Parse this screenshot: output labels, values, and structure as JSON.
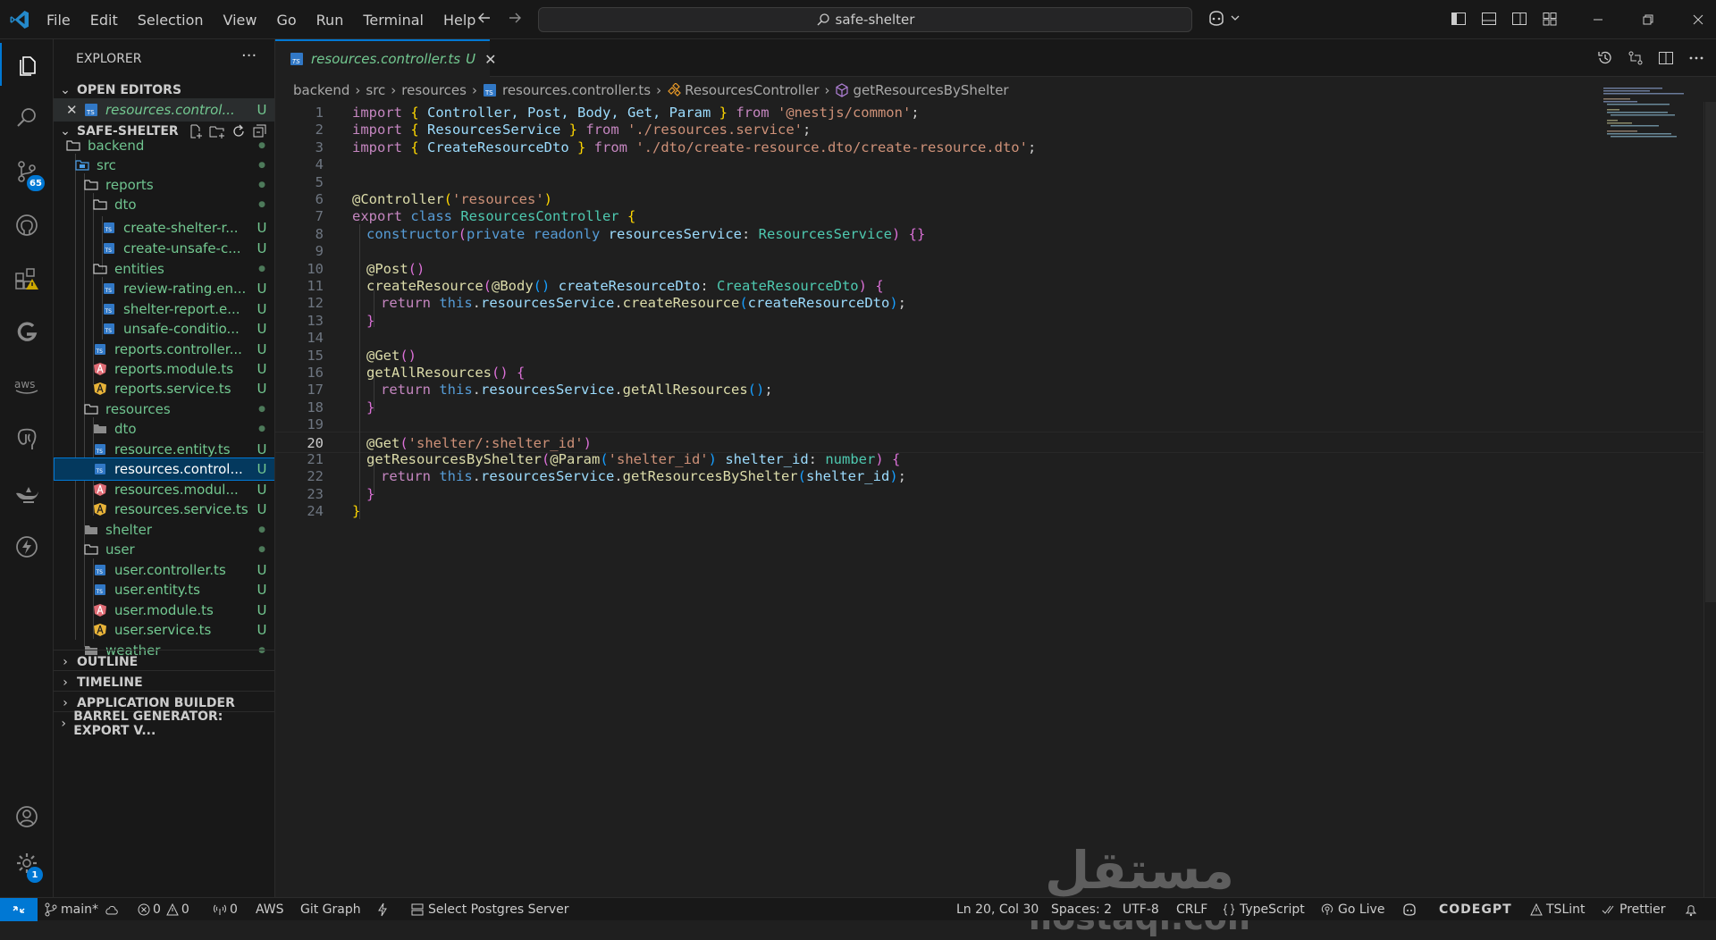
{
  "menu": {
    "file": "File",
    "edit": "Edit",
    "selection": "Selection",
    "view": "View",
    "go": "Go",
    "run": "Run",
    "terminal": "Terminal",
    "help": "Help"
  },
  "command_center": {
    "label": "safe-shelter"
  },
  "activity": {
    "scm_badge": "65",
    "accounts_badge": "1"
  },
  "sidebar": {
    "title": "EXPLORER",
    "more": "···",
    "open_editors": "OPEN EDITORS",
    "open_editor_file": {
      "name": "resources.control...",
      "status": "U"
    },
    "workspace": "SAFE-SHELTER",
    "tree": [
      {
        "name": "backend",
        "status": "●"
      },
      {
        "name": "src",
        "status": "●"
      },
      {
        "name": "reports",
        "status": "●"
      },
      {
        "name": "dto",
        "status": "●"
      },
      {
        "name": "create-shelter-r...",
        "status": "U"
      },
      {
        "name": "create-unsafe-c...",
        "status": "U"
      },
      {
        "name": "entities",
        "status": "●"
      },
      {
        "name": "review-rating.en...",
        "status": "U"
      },
      {
        "name": "shelter-report.e...",
        "status": "U"
      },
      {
        "name": "unsafe-conditio...",
        "status": "U"
      },
      {
        "name": "reports.controller...",
        "status": "U"
      },
      {
        "name": "reports.module.ts",
        "status": "U"
      },
      {
        "name": "reports.service.ts",
        "status": "U"
      },
      {
        "name": "resources",
        "status": "●"
      },
      {
        "name": "dto",
        "status": "●"
      },
      {
        "name": "resource.entity.ts",
        "status": "U"
      },
      {
        "name": "resources.control...",
        "status": "U"
      },
      {
        "name": "resources.modul...",
        "status": "U"
      },
      {
        "name": "resources.service.ts",
        "status": "U"
      },
      {
        "name": "shelter",
        "status": "●"
      },
      {
        "name": "user",
        "status": "●"
      },
      {
        "name": "user.controller.ts",
        "status": "U"
      },
      {
        "name": "user.entity.ts",
        "status": "U"
      },
      {
        "name": "user.module.ts",
        "status": "U"
      },
      {
        "name": "user.service.ts",
        "status": "U"
      },
      {
        "name": "weather",
        "status": "●"
      }
    ],
    "sections": {
      "outline": "OUTLINE",
      "timeline": "TIMELINE",
      "app_builder": "APPLICATION BUILDER",
      "barrel": "BARREL GENERATOR: EXPORT V..."
    }
  },
  "tab": {
    "label": "resources.controller.ts",
    "status": "U",
    "close": "✕"
  },
  "breadcrumb": {
    "a": "backend",
    "b": "src",
    "c": "resources",
    "d": "resources.controller.ts",
    "e": "ResourcesController",
    "f": "getResourcesByShelter"
  },
  "line_numbers": [
    "1",
    "2",
    "3",
    "4",
    "5",
    "6",
    "7",
    "8",
    "9",
    "10",
    "11",
    "12",
    "13",
    "14",
    "15",
    "16",
    "17",
    "18",
    "19",
    "20",
    "21",
    "22",
    "23",
    "24"
  ],
  "code": {
    "l1": [
      "import",
      " ",
      "{",
      " Controller, Post, Body, Get, Param ",
      "}",
      " from ",
      "'@nestjs/common'",
      ";"
    ],
    "l2": [
      "import",
      " ",
      "{",
      " ResourcesService ",
      "}",
      " from ",
      "'./resources.service'",
      ";"
    ],
    "l3": [
      "import",
      " ",
      "{",
      " CreateResourceDto ",
      "}",
      " from ",
      "'./dto/create-resource.dto/create-resource.dto'",
      ";"
    ],
    "l6": [
      "@Controller",
      "(",
      "'resources'",
      ")"
    ],
    "l7": [
      "export",
      " class ",
      "ResourcesController",
      " ",
      "{"
    ],
    "l8": [
      "constructor",
      "(",
      "private",
      " ",
      "readonly",
      " ",
      "resourcesService",
      ": ",
      "ResourcesService",
      ")",
      " ",
      "{}"
    ],
    "l10": [
      "@Post",
      "()"
    ],
    "l11": [
      "createResource",
      "(",
      "@Body",
      "()",
      " ",
      "createResourceDto",
      ": ",
      "CreateResourceDto",
      ")",
      " ",
      "{"
    ],
    "l12": [
      "return",
      " ",
      "this",
      ".",
      "resourcesService",
      ".",
      "createResource",
      "(",
      "createResourceDto",
      ")",
      ";"
    ],
    "l13": [
      "}"
    ],
    "l15": [
      "@Get",
      "()"
    ],
    "l16": [
      "getAllResources",
      "()",
      " ",
      "{"
    ],
    "l17": [
      "return",
      " ",
      "this",
      ".",
      "resourcesService",
      ".",
      "getAllResources",
      "()",
      ";"
    ],
    "l18": [
      "}"
    ],
    "l20": [
      "@Get",
      "(",
      "'shelter/:shelter_id'",
      ")"
    ],
    "l21": [
      "getResourcesByShelter",
      "(",
      "@Param",
      "(",
      "'shelter_id'",
      ")",
      " ",
      "shelter_id",
      ": ",
      "number",
      ")",
      " ",
      "{"
    ],
    "l22": [
      "return",
      " ",
      "this",
      ".",
      "resourcesService",
      ".",
      "getResourcesByShelter",
      "(",
      "shelter_id",
      ")",
      ";"
    ],
    "l23": [
      "}"
    ],
    "l24": [
      "}"
    ]
  },
  "watermark": {
    "arabic": "مستقل",
    "latin": "mostaql.com"
  },
  "status": {
    "branch": "main*",
    "errors": "0",
    "warnings": "0",
    "ports": "0",
    "aws": "AWS",
    "git_graph": "Git Graph",
    "postgres": "Select Postgres Server",
    "position": "Ln 20, Col 30",
    "spaces": "Spaces: 2",
    "encoding": "UTF-8",
    "eol": "CRLF",
    "language": "TypeScript",
    "golive": "Go Live",
    "codegpt": "CODEGPT",
    "tslint": "TSLint",
    "prettier": "Prettier"
  },
  "colors": {
    "accent": "#0078d4",
    "untracked": "#73c991",
    "keyword": "#569cd6",
    "control": "#c586c0",
    "string": "#ce9178",
    "variable": "#9cdcfe",
    "type": "#4ec9b0",
    "function": "#dcdcaa"
  }
}
